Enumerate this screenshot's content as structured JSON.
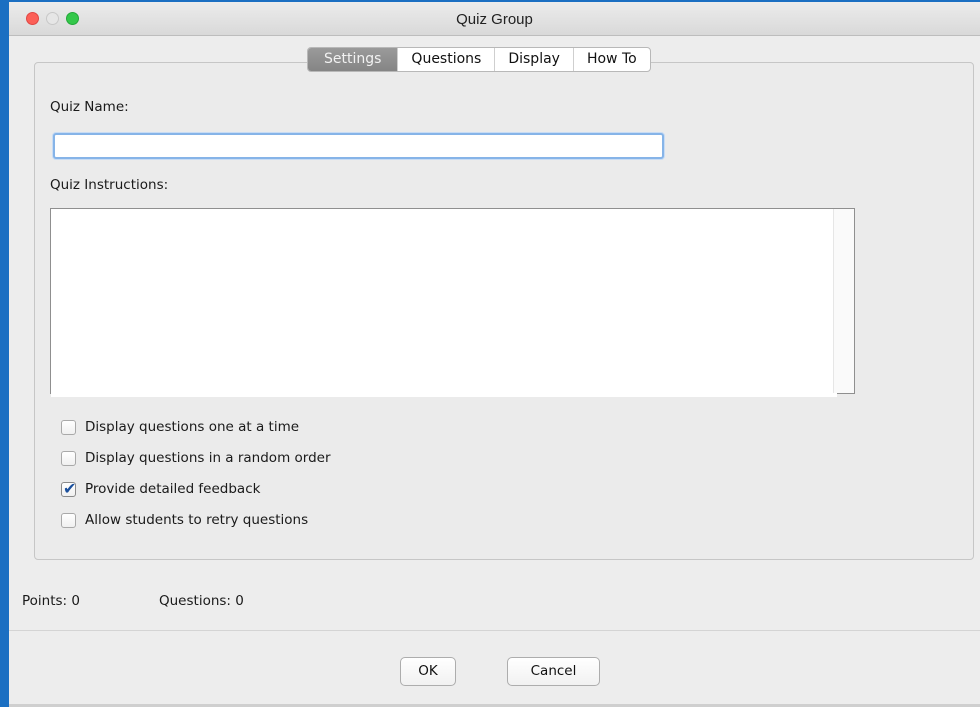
{
  "window": {
    "title": "Quiz Group"
  },
  "tabs": [
    {
      "label": "Settings",
      "active": true
    },
    {
      "label": "Questions",
      "active": false
    },
    {
      "label": "Display",
      "active": false
    },
    {
      "label": "How To",
      "active": false
    }
  ],
  "settings": {
    "quiz_name_label": "Quiz Name:",
    "quiz_name_value": "",
    "quiz_instructions_label": "Quiz Instructions:",
    "quiz_instructions_value": "",
    "options": [
      {
        "label": "Display questions one at a time",
        "checked": false
      },
      {
        "label": "Display questions in a random order",
        "checked": false
      },
      {
        "label": "Provide detailed feedback",
        "checked": true
      },
      {
        "label": "Allow students to retry questions",
        "checked": false
      }
    ]
  },
  "status": {
    "points": "Points: 0",
    "questions": "Questions: 0"
  },
  "buttons": {
    "ok": "OK",
    "cancel": "Cancel"
  },
  "colors": {
    "accent": "#1b6fc2",
    "focus_ring": "#86b4e8",
    "checkmark": "#1a4f9c"
  }
}
